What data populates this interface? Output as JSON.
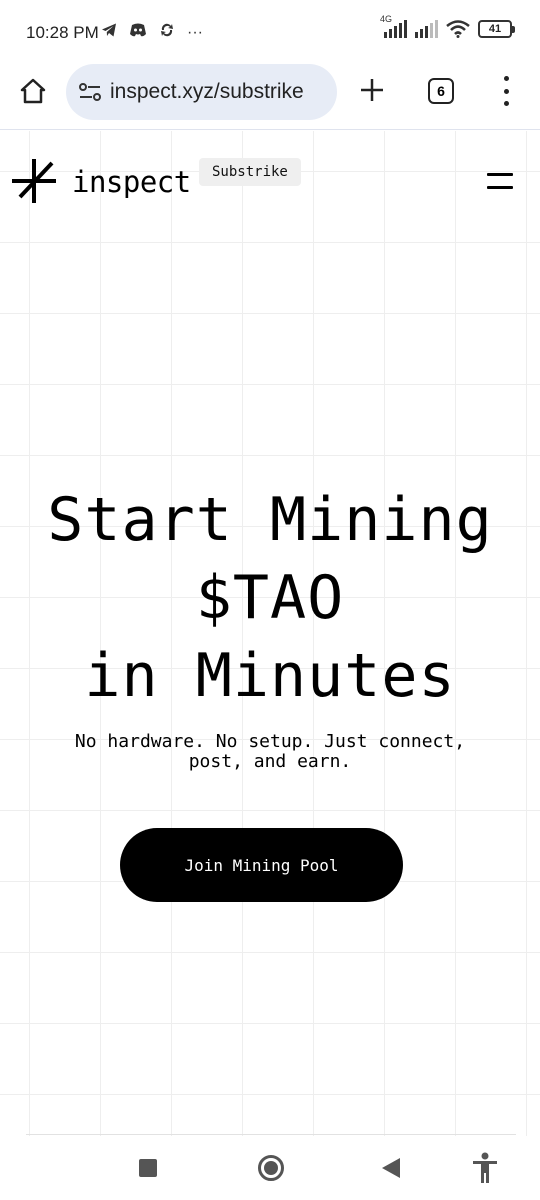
{
  "status_bar": {
    "time": "10:28 PM",
    "network_label": "4G",
    "battery": "41",
    "more_indicator": "···"
  },
  "browser": {
    "url": "inspect.xyz/substrike",
    "tab_count": "6"
  },
  "site": {
    "logo_text": "inspect",
    "tag": "Substrike"
  },
  "hero": {
    "title_line1": "Start Mining",
    "title_line2": "$TAO",
    "title_line3": "in Minutes",
    "subtitle_line1": "No hardware. No setup. Just connect,",
    "subtitle_line2": "post, and earn.",
    "cta_label": "Join Mining Pool"
  }
}
